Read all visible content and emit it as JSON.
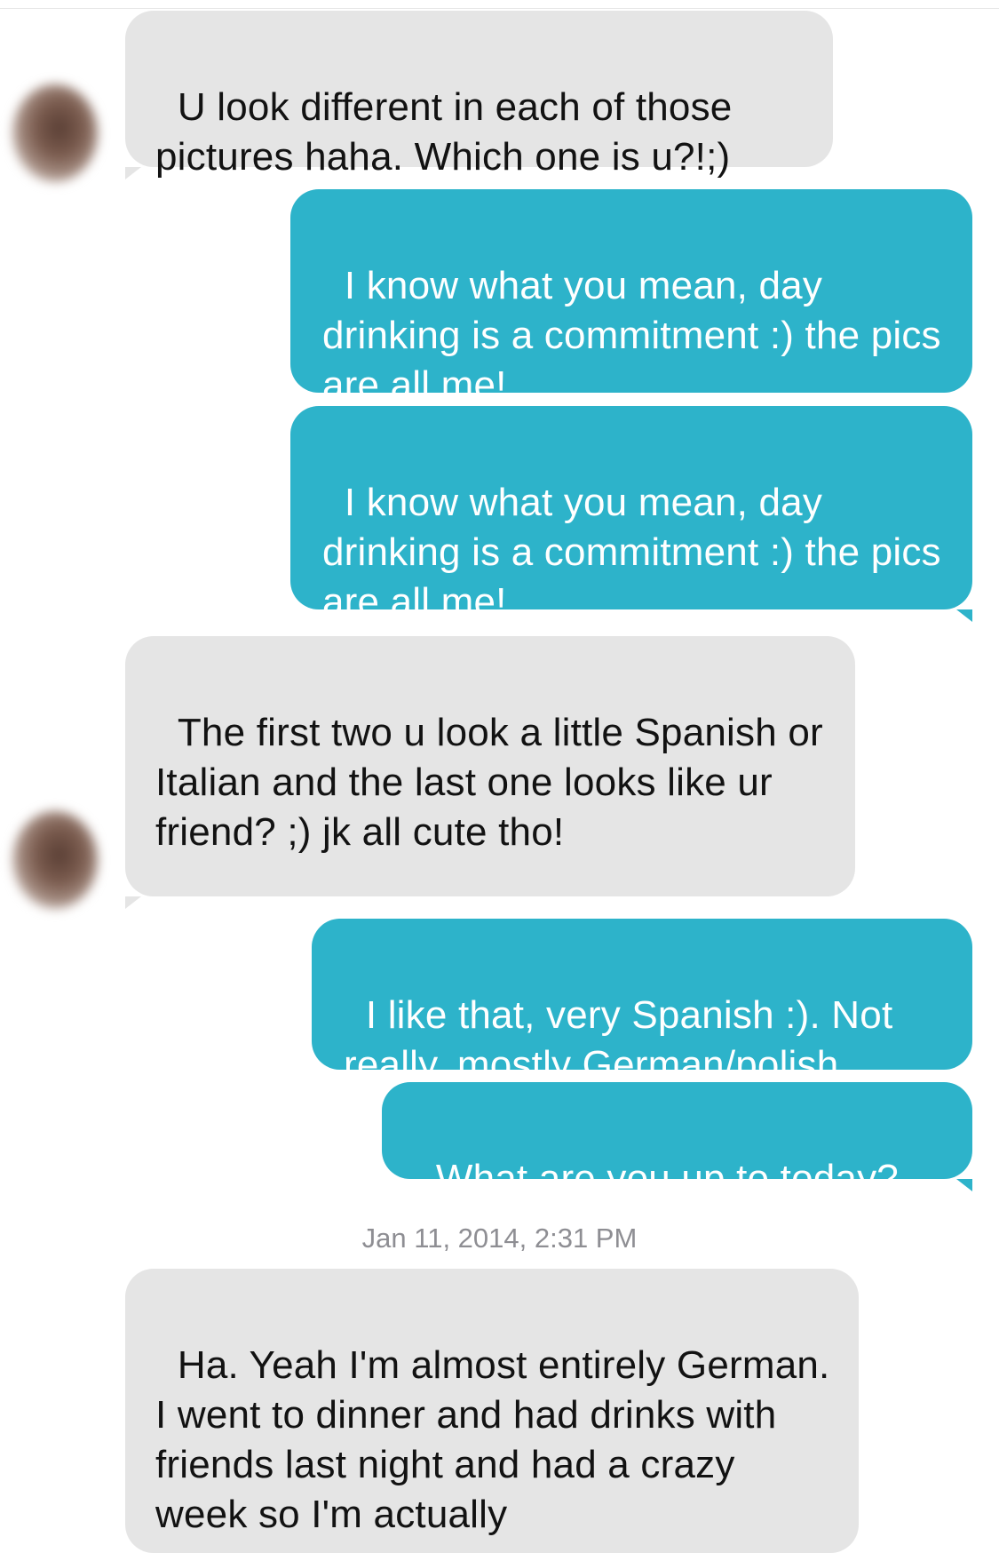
{
  "colors": {
    "incoming_bubble": "#e5e5e5",
    "outgoing_bubble": "#2db3ca",
    "incoming_text": "#121212",
    "outgoing_text": "#ffffff",
    "timestamp_text": "#8e8e93"
  },
  "messages": [
    {
      "direction": "incoming",
      "text": "U look different in each of those pictures haha. Which one is u?!;)"
    },
    {
      "direction": "outgoing",
      "text": "I know what you mean, day drinking is a commitment :) the pics are all me!"
    },
    {
      "direction": "outgoing",
      "text": "I know what you mean, day drinking is a commitment :) the pics are all me!"
    },
    {
      "direction": "incoming",
      "text": "The first two u look a little Spanish or Italian and the last one looks like ur friend? ;) jk all cute tho!"
    },
    {
      "direction": "outgoing",
      "text": "I like that, very Spanish :). Not really, mostly German/polish."
    },
    {
      "direction": "outgoing",
      "text": "What are you up to today?"
    },
    {
      "direction": "incoming",
      "text": "Ha. Yeah I'm almost entirely German. I went to dinner and had drinks with friends last night and had a crazy week so I'm actually"
    }
  ],
  "timestamp": "Jan 11, 2014, 2:31 PM",
  "icons": {
    "avatar": "contact-avatar-blurred"
  }
}
